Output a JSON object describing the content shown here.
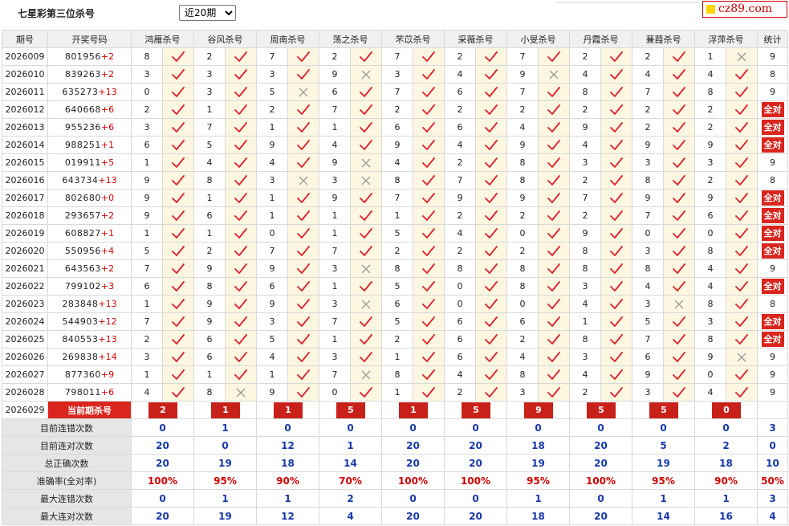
{
  "header": {
    "title": "七星彩第三位杀号",
    "period_select": {
      "selected": "近20期",
      "options": [
        "近20期"
      ]
    },
    "logo_text": "cz89.com"
  },
  "colors": {
    "accent_red": "#d9251d",
    "check_red": "#e0202a",
    "cross_gray": "#9a9a9a",
    "summary_blue": "#1738a8",
    "mark_bg": "#fdf6e1"
  },
  "columns": {
    "period": "期号",
    "draw": "开奖号码",
    "experts": [
      "鸿雁杀号",
      "谷风杀号",
      "周南杀号",
      "荡之杀号",
      "芣苡杀号",
      "采薇杀号",
      "小旻杀号",
      "丹霞杀号",
      "蒹葭杀号",
      "浮萍杀号"
    ],
    "stat": "统计"
  },
  "rows": [
    {
      "period": "2026009",
      "digits": "801956",
      "sum": "+2",
      "kills": [
        "8",
        "2",
        "7",
        "2",
        "7",
        "2",
        "7",
        "2",
        "2",
        "1"
      ],
      "marks": [
        1,
        1,
        1,
        1,
        1,
        1,
        1,
        1,
        1,
        0
      ],
      "stat": "9"
    },
    {
      "period": "2026010",
      "digits": "839263",
      "sum": "+2",
      "kills": [
        "3",
        "3",
        "3",
        "9",
        "3",
        "4",
        "9",
        "4",
        "4",
        "4"
      ],
      "marks": [
        1,
        1,
        1,
        0,
        1,
        1,
        0,
        1,
        1,
        1
      ],
      "stat": "8"
    },
    {
      "period": "2026011",
      "digits": "635273",
      "sum": "+13",
      "kills": [
        "0",
        "3",
        "5",
        "6",
        "7",
        "6",
        "7",
        "8",
        "7",
        "8"
      ],
      "marks": [
        1,
        1,
        0,
        1,
        1,
        1,
        1,
        1,
        1,
        1
      ],
      "stat": "9"
    },
    {
      "period": "2026012",
      "digits": "640668",
      "sum": "+6",
      "kills": [
        "2",
        "1",
        "2",
        "7",
        "2",
        "2",
        "2",
        "2",
        "2",
        "2"
      ],
      "marks": [
        1,
        1,
        1,
        1,
        1,
        1,
        1,
        1,
        1,
        1
      ],
      "stat": "全对"
    },
    {
      "period": "2026013",
      "digits": "955236",
      "sum": "+6",
      "kills": [
        "3",
        "7",
        "1",
        "1",
        "6",
        "6",
        "4",
        "9",
        "2",
        "2"
      ],
      "marks": [
        1,
        1,
        1,
        1,
        1,
        1,
        1,
        1,
        1,
        1
      ],
      "stat": "全对"
    },
    {
      "period": "2026014",
      "digits": "988251",
      "sum": "+1",
      "kills": [
        "6",
        "5",
        "9",
        "4",
        "9",
        "4",
        "9",
        "4",
        "9",
        "9"
      ],
      "marks": [
        1,
        1,
        1,
        1,
        1,
        1,
        1,
        1,
        1,
        1
      ],
      "stat": "全对"
    },
    {
      "period": "2026015",
      "digits": "019911",
      "sum": "+5",
      "kills": [
        "1",
        "4",
        "4",
        "9",
        "4",
        "2",
        "8",
        "3",
        "3",
        "3"
      ],
      "marks": [
        1,
        1,
        1,
        0,
        1,
        1,
        1,
        1,
        1,
        1
      ],
      "stat": "9"
    },
    {
      "period": "2026016",
      "digits": "643734",
      "sum": "+13",
      "kills": [
        "9",
        "8",
        "3",
        "3",
        "8",
        "7",
        "8",
        "2",
        "8",
        "2"
      ],
      "marks": [
        1,
        1,
        0,
        0,
        1,
        1,
        1,
        1,
        1,
        1
      ],
      "stat": "8"
    },
    {
      "period": "2026017",
      "digits": "802680",
      "sum": "+0",
      "kills": [
        "9",
        "1",
        "1",
        "9",
        "7",
        "9",
        "9",
        "7",
        "9",
        "9"
      ],
      "marks": [
        1,
        1,
        1,
        1,
        1,
        1,
        1,
        1,
        1,
        1
      ],
      "stat": "全对"
    },
    {
      "period": "2026018",
      "digits": "293657",
      "sum": "+2",
      "kills": [
        "9",
        "6",
        "1",
        "1",
        "1",
        "2",
        "2",
        "2",
        "7",
        "6"
      ],
      "marks": [
        1,
        1,
        1,
        1,
        1,
        1,
        1,
        1,
        1,
        1
      ],
      "stat": "全对"
    },
    {
      "period": "2026019",
      "digits": "608827",
      "sum": "+1",
      "kills": [
        "1",
        "1",
        "0",
        "1",
        "5",
        "4",
        "0",
        "9",
        "0",
        "0"
      ],
      "marks": [
        1,
        1,
        1,
        1,
        1,
        1,
        1,
        1,
        1,
        1
      ],
      "stat": "全对"
    },
    {
      "period": "2026020",
      "digits": "550956",
      "sum": "+4",
      "kills": [
        "5",
        "2",
        "7",
        "7",
        "2",
        "2",
        "2",
        "8",
        "3",
        "8"
      ],
      "marks": [
        1,
        1,
        1,
        1,
        1,
        1,
        1,
        1,
        1,
        1
      ],
      "stat": "全对"
    },
    {
      "period": "2026021",
      "digits": "643563",
      "sum": "+2",
      "kills": [
        "7",
        "9",
        "9",
        "3",
        "8",
        "8",
        "8",
        "8",
        "8",
        "4"
      ],
      "marks": [
        1,
        1,
        1,
        0,
        1,
        1,
        1,
        1,
        1,
        1
      ],
      "stat": "9"
    },
    {
      "period": "2026022",
      "digits": "799102",
      "sum": "+3",
      "kills": [
        "6",
        "8",
        "6",
        "1",
        "5",
        "0",
        "8",
        "3",
        "4",
        "4"
      ],
      "marks": [
        1,
        1,
        1,
        1,
        1,
        1,
        1,
        1,
        1,
        1
      ],
      "stat": "全对"
    },
    {
      "period": "2026023",
      "digits": "283848",
      "sum": "+13",
      "kills": [
        "1",
        "9",
        "9",
        "3",
        "6",
        "0",
        "0",
        "4",
        "3",
        "8"
      ],
      "marks": [
        1,
        1,
        1,
        0,
        1,
        1,
        1,
        1,
        0,
        1
      ],
      "stat": "8"
    },
    {
      "period": "2026024",
      "digits": "544903",
      "sum": "+12",
      "kills": [
        "7",
        "9",
        "3",
        "7",
        "5",
        "6",
        "6",
        "1",
        "5",
        "3"
      ],
      "marks": [
        1,
        1,
        1,
        1,
        1,
        1,
        1,
        1,
        1,
        1
      ],
      "stat": "全对"
    },
    {
      "period": "2026025",
      "digits": "840553",
      "sum": "+13",
      "kills": [
        "2",
        "6",
        "5",
        "1",
        "2",
        "6",
        "2",
        "8",
        "7",
        "8"
      ],
      "marks": [
        1,
        1,
        1,
        1,
        1,
        1,
        1,
        1,
        1,
        1
      ],
      "stat": "全对"
    },
    {
      "period": "2026026",
      "digits": "269838",
      "sum": "+14",
      "kills": [
        "3",
        "6",
        "4",
        "3",
        "1",
        "6",
        "4",
        "3",
        "6",
        "9"
      ],
      "marks": [
        1,
        1,
        1,
        1,
        1,
        1,
        1,
        1,
        1,
        0
      ],
      "stat": "9"
    },
    {
      "period": "2026027",
      "digits": "877360",
      "sum": "+9",
      "kills": [
        "1",
        "1",
        "1",
        "7",
        "8",
        "4",
        "8",
        "4",
        "9",
        "0"
      ],
      "marks": [
        1,
        1,
        1,
        0,
        1,
        1,
        1,
        1,
        1,
        1
      ],
      "stat": "9"
    },
    {
      "period": "2026028",
      "digits": "798011",
      "sum": "+6",
      "kills": [
        "4",
        "8",
        "9",
        "0",
        "1",
        "2",
        "3",
        "2",
        "3",
        "4"
      ],
      "marks": [
        1,
        0,
        1,
        1,
        1,
        1,
        1,
        1,
        1,
        1
      ],
      "stat": "9"
    }
  ],
  "current": {
    "period": "2026029",
    "label": "当前期杀号",
    "kills": [
      "2",
      "1",
      "1",
      "5",
      "1",
      "5",
      "9",
      "5",
      "5",
      "0"
    ]
  },
  "summary": [
    {
      "label": "目前连错次数",
      "values": [
        "0",
        "1",
        "0",
        "0",
        "0",
        "0",
        "0",
        "0",
        "0",
        "0",
        "3"
      ]
    },
    {
      "label": "目前连对次数",
      "values": [
        "20",
        "0",
        "12",
        "1",
        "20",
        "20",
        "18",
        "20",
        "5",
        "2",
        "0"
      ]
    },
    {
      "label": "总正确次数",
      "values": [
        "20",
        "19",
        "18",
        "14",
        "20",
        "20",
        "19",
        "20",
        "19",
        "18",
        "10"
      ]
    },
    {
      "label": "准确率(全对率)",
      "values": [
        "100%",
        "95%",
        "90%",
        "70%",
        "100%",
        "100%",
        "95%",
        "100%",
        "95%",
        "90%",
        "50%"
      ],
      "red": true
    },
    {
      "label": "最大连错次数",
      "values": [
        "0",
        "1",
        "1",
        "2",
        "0",
        "0",
        "1",
        "0",
        "1",
        "1",
        "3"
      ]
    },
    {
      "label": "最大连对次数",
      "values": [
        "20",
        "19",
        "12",
        "4",
        "20",
        "20",
        "18",
        "20",
        "14",
        "16",
        "4"
      ]
    }
  ]
}
